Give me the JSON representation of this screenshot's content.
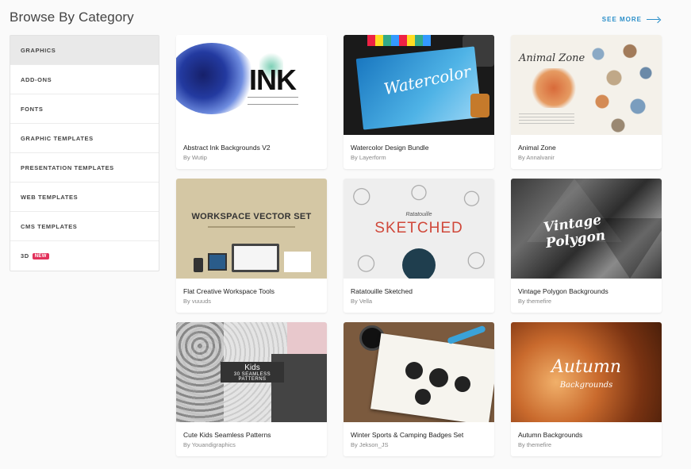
{
  "header": {
    "title": "Browse By Category",
    "see_more": "SEE MORE"
  },
  "sidebar": {
    "items": [
      {
        "label": "GRAPHICS",
        "active": true
      },
      {
        "label": "ADD-ONS"
      },
      {
        "label": "FONTS"
      },
      {
        "label": "GRAPHIC TEMPLATES"
      },
      {
        "label": "PRESENTATION TEMPLATES"
      },
      {
        "label": "WEB TEMPLATES"
      },
      {
        "label": "CMS TEMPLATES"
      },
      {
        "label": "3D",
        "badge": "NEW"
      }
    ]
  },
  "products": [
    {
      "title": "Abstract Ink Backgrounds V2",
      "author": "By Wutip",
      "art_text": "INK"
    },
    {
      "title": "Watercolor Design Bundle",
      "author": "By Layerform",
      "art_text": "Watercolor"
    },
    {
      "title": "Animal Zone",
      "author": "By Annalvanir",
      "art_text": "Animal Zone"
    },
    {
      "title": "Flat Creative Workspace Tools",
      "author": "By vuuuds",
      "art_text": "WORKSPACE VECTOR SET"
    },
    {
      "title": "Ratatouille Sketched",
      "author": "By Vella",
      "art_text": "SKETCHED",
      "art_small": "Ratatouille"
    },
    {
      "title": "Vintage Polygon Backgrounds",
      "author": "By themefire",
      "art_text": "Vintage Polygon"
    },
    {
      "title": "Cute Kids Seamless Patterns",
      "author": "By Youandigraphics",
      "art_text": "Kids",
      "art_small": "30 SEAMLESS PATTERNS"
    },
    {
      "title": "Winter Sports & Camping Badges Set",
      "author": "By Jekson_JS",
      "art_text": ""
    },
    {
      "title": "Autumn Backgrounds",
      "author": "By themefire",
      "art_text": "Autumn",
      "art_small": "Backgrounds"
    }
  ],
  "colors": {
    "accent": "#2b8fc9",
    "badge_new": "#e2315b",
    "active_bg": "#e9e9e9"
  }
}
